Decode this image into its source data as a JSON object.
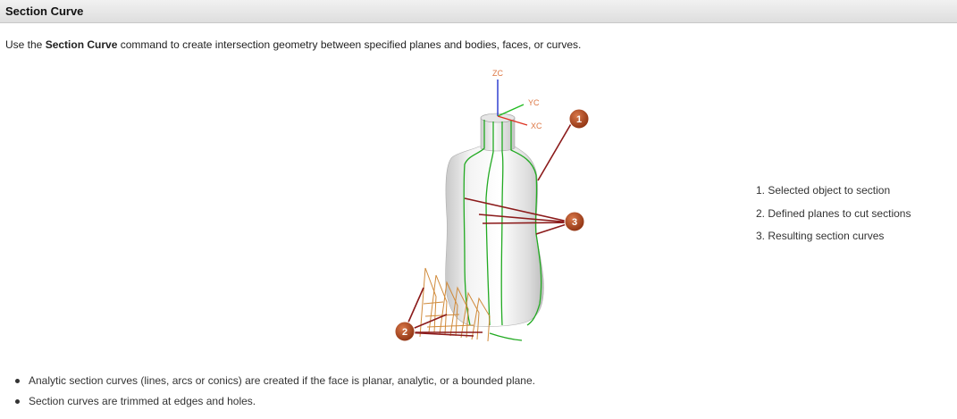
{
  "header": {
    "title": "Section Curve"
  },
  "intro": {
    "before": "Use the ",
    "bold": "Section Curve",
    "after": " command to create intersection geometry between specified planes and bodies, faces, or curves."
  },
  "figure": {
    "axes": {
      "z": "ZC",
      "y": "YC",
      "x": "XC"
    },
    "callouts": [
      "1",
      "2",
      "3"
    ],
    "colors": {
      "callout": "#9a3a14",
      "leader": "#8b1a1a",
      "section_curve": "#22aa22",
      "plane": "#d08a3a",
      "z_axis": "#2233cc",
      "y_axis": "#22bb22",
      "x_axis": "#dd3322"
    }
  },
  "legend": [
    {
      "number": "1.",
      "text": "Selected object to section"
    },
    {
      "number": "2.",
      "text": "Defined planes to cut sections"
    },
    {
      "number": "3.",
      "text": "Resulting section curves"
    }
  ],
  "bullets": [
    "Analytic section curves (lines, arcs or conics) are created if the face is planar, analytic, or a bounded plane.",
    "Section curves are trimmed at edges and holes."
  ]
}
